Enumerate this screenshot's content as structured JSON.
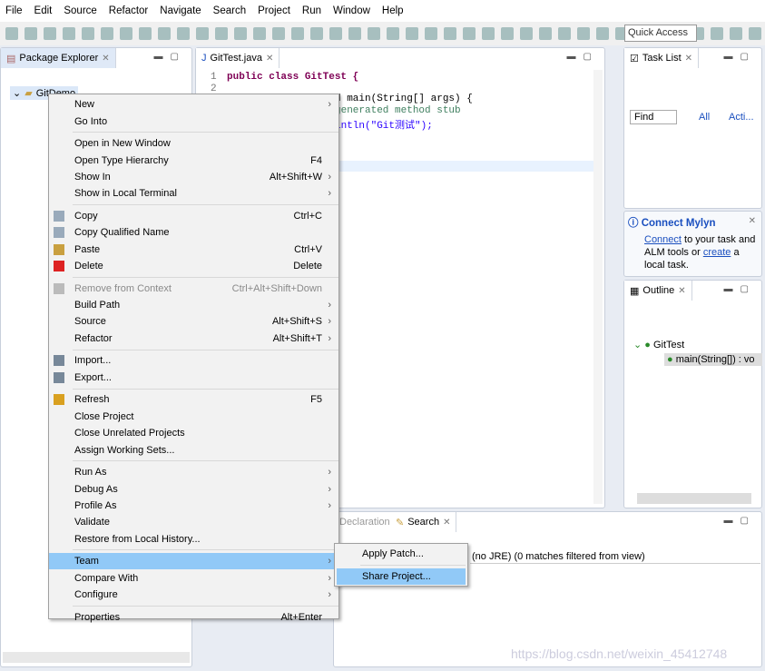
{
  "menubar": [
    "File",
    "Edit",
    "Source",
    "Refactor",
    "Navigate",
    "Search",
    "Project",
    "Run",
    "Window",
    "Help"
  ],
  "quick_access": "Quick Access",
  "package_explorer": {
    "title": "Package Explorer",
    "project": "GitDemo"
  },
  "editor": {
    "tab": "GitTest.java",
    "lines": [
      "1",
      "2"
    ],
    "code": [
      "public class GitTest {",
      "d main(String[] args) {",
      "generated method stub",
      "intln(\"Git测试\");"
    ]
  },
  "task_list": {
    "title": "Task List",
    "find": "Find",
    "all": "All",
    "activate": "Acti..."
  },
  "mylyn": {
    "title": "Connect Mylyn",
    "connect": "Connect",
    "text1": " to your task and",
    "text2": "ALM tools or ",
    "create": "create",
    "text3": " a",
    "text4": "local task."
  },
  "outline": {
    "title": "Outline",
    "class": "GitTest",
    "method": "main(String[]) : vo"
  },
  "bottom": {
    "tab_declaration": "Declaration",
    "tab_search": "Search",
    "status": "(no JRE) (0 matches filtered from view)"
  },
  "watermark": "https://blog.csdn.net/weixin_45412748",
  "context_menu": [
    [
      {
        "label": "New",
        "arrow": true
      },
      {
        "label": "Go Into"
      }
    ],
    [
      {
        "label": "Open in New Window"
      },
      {
        "label": "Open Type Hierarchy",
        "shortcut": "F4"
      },
      {
        "label": "Show In",
        "shortcut": "Alt+Shift+W",
        "arrow": true
      },
      {
        "label": "Show in Local Terminal",
        "arrow": true
      }
    ],
    [
      {
        "label": "Copy",
        "shortcut": "Ctrl+C",
        "icon": "copy-icon"
      },
      {
        "label": "Copy Qualified Name",
        "icon": "copy-icon"
      },
      {
        "label": "Paste",
        "shortcut": "Ctrl+V",
        "icon": "paste-icon"
      },
      {
        "label": "Delete",
        "shortcut": "Delete",
        "icon": "delete-icon"
      }
    ],
    [
      {
        "label": "Remove from Context",
        "shortcut": "Ctrl+Alt+Shift+Down",
        "disabled": true,
        "icon": "remove-icon"
      },
      {
        "label": "Build Path",
        "arrow": true
      },
      {
        "label": "Source",
        "shortcut": "Alt+Shift+S",
        "arrow": true
      },
      {
        "label": "Refactor",
        "shortcut": "Alt+Shift+T",
        "arrow": true
      }
    ],
    [
      {
        "label": "Import...",
        "icon": "import-icon"
      },
      {
        "label": "Export...",
        "icon": "export-icon"
      }
    ],
    [
      {
        "label": "Refresh",
        "shortcut": "F5",
        "icon": "refresh-icon"
      },
      {
        "label": "Close Project"
      },
      {
        "label": "Close Unrelated Projects"
      },
      {
        "label": "Assign Working Sets..."
      }
    ],
    [
      {
        "label": "Run As",
        "arrow": true
      },
      {
        "label": "Debug As",
        "arrow": true
      },
      {
        "label": "Profile As",
        "arrow": true
      },
      {
        "label": "Validate"
      },
      {
        "label": "Restore from Local History..."
      }
    ],
    [
      {
        "label": "Team",
        "arrow": true,
        "highlighted": true
      },
      {
        "label": "Compare With",
        "arrow": true
      },
      {
        "label": "Configure",
        "arrow": true
      }
    ],
    [
      {
        "label": "Properties",
        "shortcut": "Alt+Enter"
      }
    ]
  ],
  "team_submenu": [
    {
      "label": "Apply Patch..."
    },
    {
      "label": "Share Project...",
      "highlighted": true
    }
  ],
  "colors": {
    "highlight": "#91c9f7",
    "keyword": "#7f0055",
    "link": "#1a4fbf"
  }
}
